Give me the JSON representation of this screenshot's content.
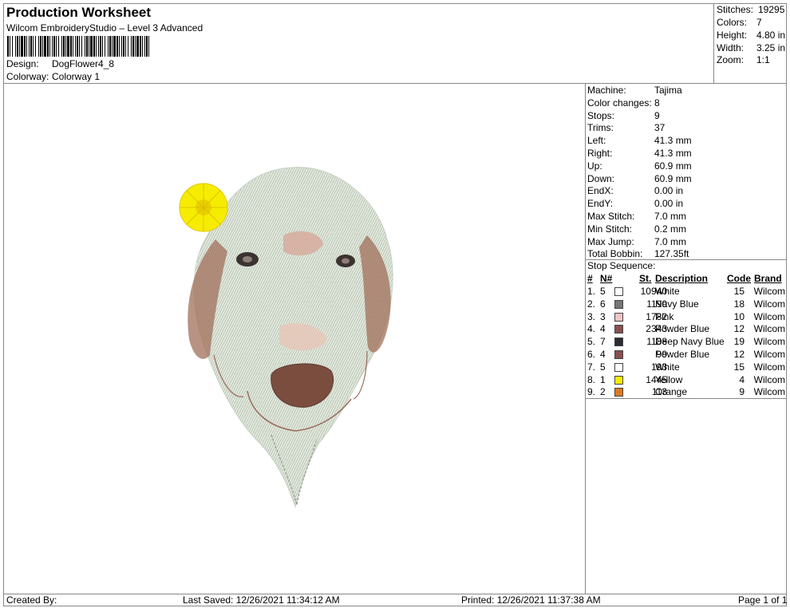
{
  "header": {
    "title": "Production Worksheet",
    "subtitle": "Wilcom EmbroideryStudio – Level 3 Advanced",
    "design_label": "Design:",
    "design_value": "DogFlower4_8",
    "colorway_label": "Colorway:",
    "colorway_value": "Colorway 1"
  },
  "stats": [
    {
      "label": "Stitches:",
      "value": "19295"
    },
    {
      "label": "Colors:",
      "value": "7"
    },
    {
      "label": "Height:",
      "value": "4.80 in"
    },
    {
      "label": "Width:",
      "value": "3.25 in"
    },
    {
      "label": "Zoom:",
      "value": "1:1"
    }
  ],
  "properties": [
    {
      "label": "Machine:",
      "value": "Tajima"
    },
    {
      "label": "Color changes:",
      "value": "8"
    },
    {
      "label": "Stops:",
      "value": "9"
    },
    {
      "label": "Trims:",
      "value": "37"
    },
    {
      "label": "Left:",
      "value": "41.3 mm"
    },
    {
      "label": "Right:",
      "value": "41.3 mm"
    },
    {
      "label": "Up:",
      "value": "60.9 mm"
    },
    {
      "label": "Down:",
      "value": "60.9 mm"
    },
    {
      "label": "EndX:",
      "value": "0.00 in"
    },
    {
      "label": "EndY:",
      "value": "0.00 in"
    },
    {
      "label": "Max Stitch:",
      "value": "7.0 mm"
    },
    {
      "label": "Min Stitch:",
      "value": "0.2 mm"
    },
    {
      "label": "Max Jump:",
      "value": "7.0 mm"
    },
    {
      "label": "Total Bobbin:",
      "value": "127.35ft"
    }
  ],
  "stop_sequence": {
    "title": "Stop Sequence:",
    "headers": {
      "num": "#",
      "needle": "N#",
      "stitches": "St.",
      "description": "Description",
      "code": "Code",
      "brand": "Brand"
    },
    "rows": [
      {
        "num": "1.",
        "needle": "5",
        "stitches": "10940",
        "description": "White",
        "code": "15",
        "brand": "Wilcom",
        "color": "#ffffff"
      },
      {
        "num": "2.",
        "needle": "6",
        "stitches": "1190",
        "description": "Navy Blue",
        "code": "18",
        "brand": "Wilcom",
        "color": "#777777"
      },
      {
        "num": "3.",
        "needle": "3",
        "stitches": "1782",
        "description": "Pink",
        "code": "10",
        "brand": "Wilcom",
        "color": "#f2c4c4"
      },
      {
        "num": "4.",
        "needle": "4",
        "stitches": "2343",
        "description": "Powder Blue",
        "code": "12",
        "brand": "Wilcom",
        "color": "#8a4f4f"
      },
      {
        "num": "5.",
        "needle": "7",
        "stitches": "1188",
        "description": "Deep Navy Blue",
        "code": "19",
        "brand": "Wilcom",
        "color": "#2b2b35"
      },
      {
        "num": "6.",
        "needle": "4",
        "stitches": "99",
        "description": "Powder Blue",
        "code": "12",
        "brand": "Wilcom",
        "color": "#8a4f4f"
      },
      {
        "num": "7.",
        "needle": "5",
        "stitches": "193",
        "description": "White",
        "code": "15",
        "brand": "Wilcom",
        "color": "#ffffff"
      },
      {
        "num": "8.",
        "needle": "1",
        "stitches": "1445",
        "description": "Yellow",
        "code": "4",
        "brand": "Wilcom",
        "color": "#f5ec00"
      },
      {
        "num": "9.",
        "needle": "2",
        "stitches": "113",
        "description": "Orange",
        "code": "9",
        "brand": "Wilcom",
        "color": "#e07a1c"
      }
    ]
  },
  "footer": {
    "created_by": "Created By:",
    "last_saved": "Last Saved: 12/26/2021 11:34:12 AM",
    "printed": "Printed: 12/26/2021 11:37:38 AM",
    "page": "Page 1 of 1"
  },
  "colors": {
    "fur": "#dfe5da",
    "ear": "#a06f5a",
    "nose": "#7a4d3f",
    "flower": "#f5ec00",
    "border": "#888888"
  }
}
